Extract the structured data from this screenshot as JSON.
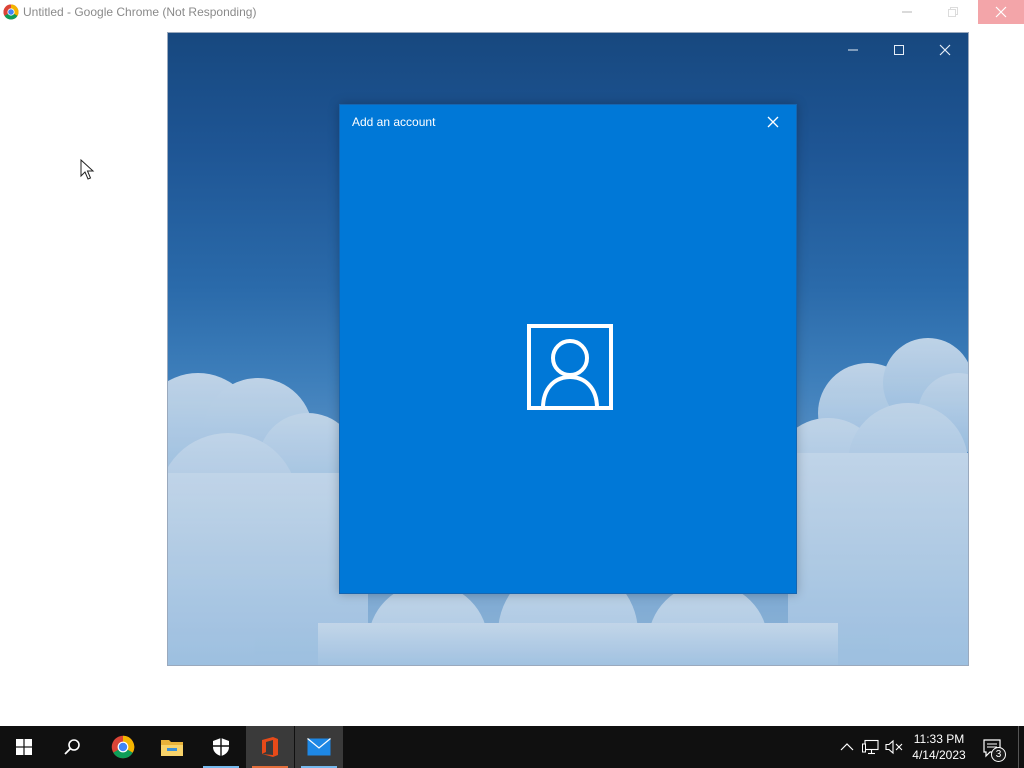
{
  "browser": {
    "title": "Untitled - Google Chrome (Not Responding)",
    "icon": "chrome-icon"
  },
  "app_window": {
    "controls": [
      "minimize-icon",
      "maximize-icon",
      "close-icon"
    ]
  },
  "dialog": {
    "title": "Add an account",
    "close_icon": "close-icon",
    "center_icon": "account-person-icon",
    "background": "#0078d7"
  },
  "taskbar": {
    "apps": [
      "start-icon",
      "search-icon",
      "chrome-icon",
      "file-explorer-icon",
      "windows-security-icon",
      "office-icon",
      "mail-icon"
    ],
    "tray": [
      "chevron-up-icon",
      "network-icon",
      "volume-muted-icon"
    ],
    "time": "11:33 PM",
    "date": "4/14/2023",
    "notification_count": "3"
  },
  "colors": {
    "accent": "#0078d7",
    "taskbar": "#101010",
    "close_hover": "#f3a5a9"
  }
}
